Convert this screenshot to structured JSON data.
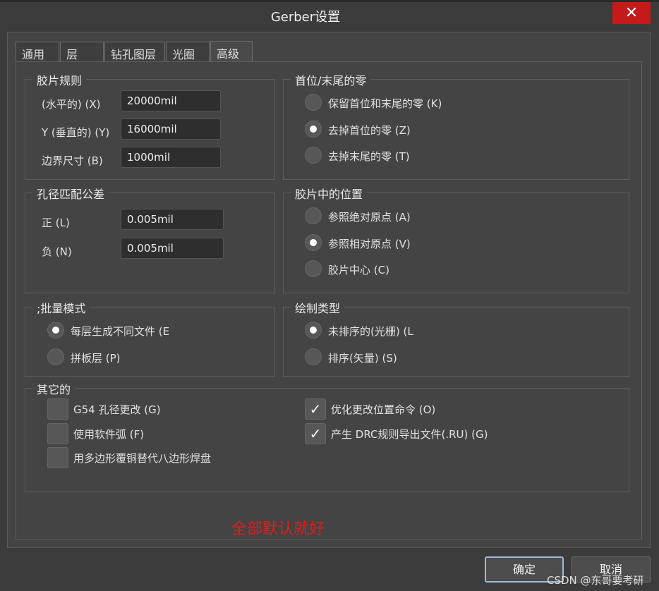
{
  "window": {
    "title": "Gerber设置",
    "close_glyph": "✕"
  },
  "tabs": [
    {
      "label": "通用"
    },
    {
      "label": "层"
    },
    {
      "label": "钻孔图层"
    },
    {
      "label": "光圈"
    },
    {
      "label": "高级",
      "active": true
    }
  ],
  "film_rules": {
    "title": "胶片规则",
    "fields": [
      {
        "label": "(水平的) (X)",
        "value": "20000mil"
      },
      {
        "label": "Y (垂直的) (Y)",
        "value": "16000mil"
      },
      {
        "label": "边界尺寸 (B)",
        "value": "1000mil"
      }
    ]
  },
  "leading_trailing_zeros": {
    "title": "首位/末尾的零",
    "options": [
      {
        "label": "保留首位和末尾的零 (K)",
        "selected": false
      },
      {
        "label": "去掉首位的零 (Z)",
        "selected": true
      },
      {
        "label": "去掉末尾的零 (T)",
        "selected": false
      }
    ]
  },
  "aperture_tolerance": {
    "title": "孔径匹配公差",
    "fields": [
      {
        "label": "正 (L)",
        "value": "0.005mil"
      },
      {
        "label": "负 (N)",
        "value": "0.005mil"
      }
    ]
  },
  "position_on_film": {
    "title": "胶片中的位置",
    "options": [
      {
        "label": "参照绝对原点 (A)",
        "selected": false
      },
      {
        "label": "参照相对原点 (V)",
        "selected": true
      },
      {
        "label": "胶片中心 (C)",
        "selected": false
      }
    ]
  },
  "batch_mode": {
    "title": ";批量模式",
    "options": [
      {
        "label": "每层生成不同文件 (E",
        "selected": true
      },
      {
        "label": "拼板层 (P)",
        "selected": false
      }
    ]
  },
  "plot_type": {
    "title": "绘制类型",
    "options": [
      {
        "label": "未排序的(光栅) (L",
        "selected": true
      },
      {
        "label": "排序(矢量) (S)",
        "selected": false
      }
    ]
  },
  "other": {
    "title": "其它的",
    "checks": [
      {
        "label": "G54 孔径更改 (G)",
        "checked": false
      },
      {
        "label": "使用软件弧 (F)",
        "checked": false
      },
      {
        "label": "用多边形覆铜替代八边形焊盘",
        "checked": false
      },
      {
        "label": "优化更改位置命令 (O)",
        "checked": true
      },
      {
        "label": "产生 DRC规则导出文件(.RU) (G)",
        "checked": true
      }
    ]
  },
  "annotation": "全部默认就好",
  "buttons": {
    "ok": "确定",
    "cancel": "取消"
  },
  "watermark": "CSDN @东哥要考研",
  "check_glyph": "✓"
}
